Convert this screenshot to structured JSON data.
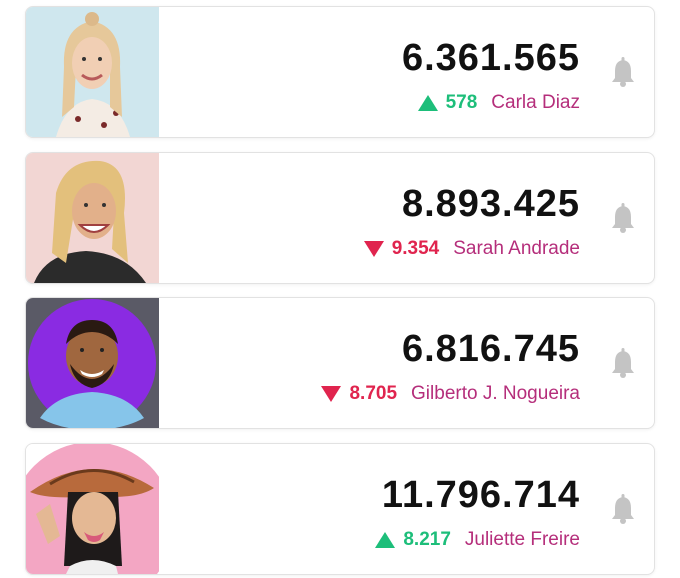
{
  "colors": {
    "up": "#1dbe7a",
    "down": "#e0244e",
    "name": "#b52e7b",
    "bell": "#c4c4c4"
  },
  "rows": [
    {
      "count": "6.361.565",
      "trend": "up",
      "delta": "578",
      "name": "Carla Diaz",
      "photo_bg": "#cfe7ee"
    },
    {
      "count": "8.893.425",
      "trend": "down",
      "delta": "9.354",
      "name": "Sarah Andrade",
      "photo_bg": "#f2d6d3"
    },
    {
      "count": "6.816.745",
      "trend": "down",
      "delta": "8.705",
      "name": "Gilberto J. Nogueira",
      "photo_bg": "#8a2be2"
    },
    {
      "count": "11.796.714",
      "trend": "up",
      "delta": "8.217",
      "name": "Juliette Freire",
      "photo_bg": "#f3a6c3"
    }
  ]
}
